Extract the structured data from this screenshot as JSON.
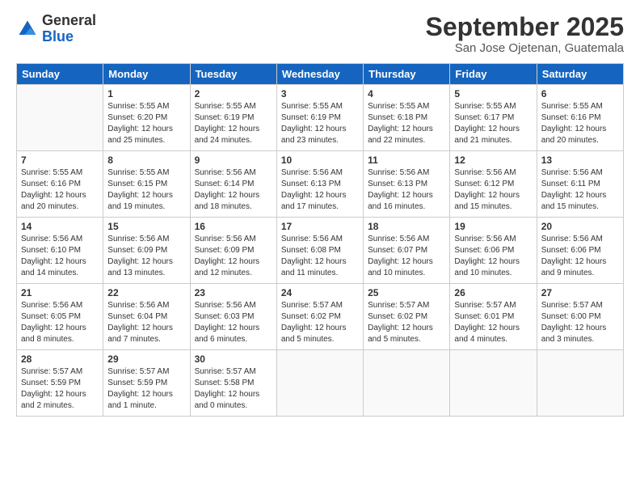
{
  "logo": {
    "general": "General",
    "blue": "Blue"
  },
  "title": "September 2025",
  "location": "San Jose Ojetenan, Guatemala",
  "weekdays": [
    "Sunday",
    "Monday",
    "Tuesday",
    "Wednesday",
    "Thursday",
    "Friday",
    "Saturday"
  ],
  "weeks": [
    [
      null,
      {
        "num": "1",
        "sunrise": "5:55 AM",
        "sunset": "6:20 PM",
        "daylight": "12 hours and 25 minutes."
      },
      {
        "num": "2",
        "sunrise": "5:55 AM",
        "sunset": "6:19 PM",
        "daylight": "12 hours and 24 minutes."
      },
      {
        "num": "3",
        "sunrise": "5:55 AM",
        "sunset": "6:19 PM",
        "daylight": "12 hours and 23 minutes."
      },
      {
        "num": "4",
        "sunrise": "5:55 AM",
        "sunset": "6:18 PM",
        "daylight": "12 hours and 22 minutes."
      },
      {
        "num": "5",
        "sunrise": "5:55 AM",
        "sunset": "6:17 PM",
        "daylight": "12 hours and 21 minutes."
      },
      {
        "num": "6",
        "sunrise": "5:55 AM",
        "sunset": "6:16 PM",
        "daylight": "12 hours and 20 minutes."
      }
    ],
    [
      {
        "num": "7",
        "sunrise": "5:55 AM",
        "sunset": "6:16 PM",
        "daylight": "12 hours and 20 minutes."
      },
      {
        "num": "8",
        "sunrise": "5:55 AM",
        "sunset": "6:15 PM",
        "daylight": "12 hours and 19 minutes."
      },
      {
        "num": "9",
        "sunrise": "5:56 AM",
        "sunset": "6:14 PM",
        "daylight": "12 hours and 18 minutes."
      },
      {
        "num": "10",
        "sunrise": "5:56 AM",
        "sunset": "6:13 PM",
        "daylight": "12 hours and 17 minutes."
      },
      {
        "num": "11",
        "sunrise": "5:56 AM",
        "sunset": "6:13 PM",
        "daylight": "12 hours and 16 minutes."
      },
      {
        "num": "12",
        "sunrise": "5:56 AM",
        "sunset": "6:12 PM",
        "daylight": "12 hours and 15 minutes."
      },
      {
        "num": "13",
        "sunrise": "5:56 AM",
        "sunset": "6:11 PM",
        "daylight": "12 hours and 15 minutes."
      }
    ],
    [
      {
        "num": "14",
        "sunrise": "5:56 AM",
        "sunset": "6:10 PM",
        "daylight": "12 hours and 14 minutes."
      },
      {
        "num": "15",
        "sunrise": "5:56 AM",
        "sunset": "6:09 PM",
        "daylight": "12 hours and 13 minutes."
      },
      {
        "num": "16",
        "sunrise": "5:56 AM",
        "sunset": "6:09 PM",
        "daylight": "12 hours and 12 minutes."
      },
      {
        "num": "17",
        "sunrise": "5:56 AM",
        "sunset": "6:08 PM",
        "daylight": "12 hours and 11 minutes."
      },
      {
        "num": "18",
        "sunrise": "5:56 AM",
        "sunset": "6:07 PM",
        "daylight": "12 hours and 10 minutes."
      },
      {
        "num": "19",
        "sunrise": "5:56 AM",
        "sunset": "6:06 PM",
        "daylight": "12 hours and 10 minutes."
      },
      {
        "num": "20",
        "sunrise": "5:56 AM",
        "sunset": "6:06 PM",
        "daylight": "12 hours and 9 minutes."
      }
    ],
    [
      {
        "num": "21",
        "sunrise": "5:56 AM",
        "sunset": "6:05 PM",
        "daylight": "12 hours and 8 minutes."
      },
      {
        "num": "22",
        "sunrise": "5:56 AM",
        "sunset": "6:04 PM",
        "daylight": "12 hours and 7 minutes."
      },
      {
        "num": "23",
        "sunrise": "5:56 AM",
        "sunset": "6:03 PM",
        "daylight": "12 hours and 6 minutes."
      },
      {
        "num": "24",
        "sunrise": "5:57 AM",
        "sunset": "6:02 PM",
        "daylight": "12 hours and 5 minutes."
      },
      {
        "num": "25",
        "sunrise": "5:57 AM",
        "sunset": "6:02 PM",
        "daylight": "12 hours and 5 minutes."
      },
      {
        "num": "26",
        "sunrise": "5:57 AM",
        "sunset": "6:01 PM",
        "daylight": "12 hours and 4 minutes."
      },
      {
        "num": "27",
        "sunrise": "5:57 AM",
        "sunset": "6:00 PM",
        "daylight": "12 hours and 3 minutes."
      }
    ],
    [
      {
        "num": "28",
        "sunrise": "5:57 AM",
        "sunset": "5:59 PM",
        "daylight": "12 hours and 2 minutes."
      },
      {
        "num": "29",
        "sunrise": "5:57 AM",
        "sunset": "5:59 PM",
        "daylight": "12 hours and 1 minute."
      },
      {
        "num": "30",
        "sunrise": "5:57 AM",
        "sunset": "5:58 PM",
        "daylight": "12 hours and 0 minutes."
      },
      null,
      null,
      null,
      null
    ]
  ]
}
